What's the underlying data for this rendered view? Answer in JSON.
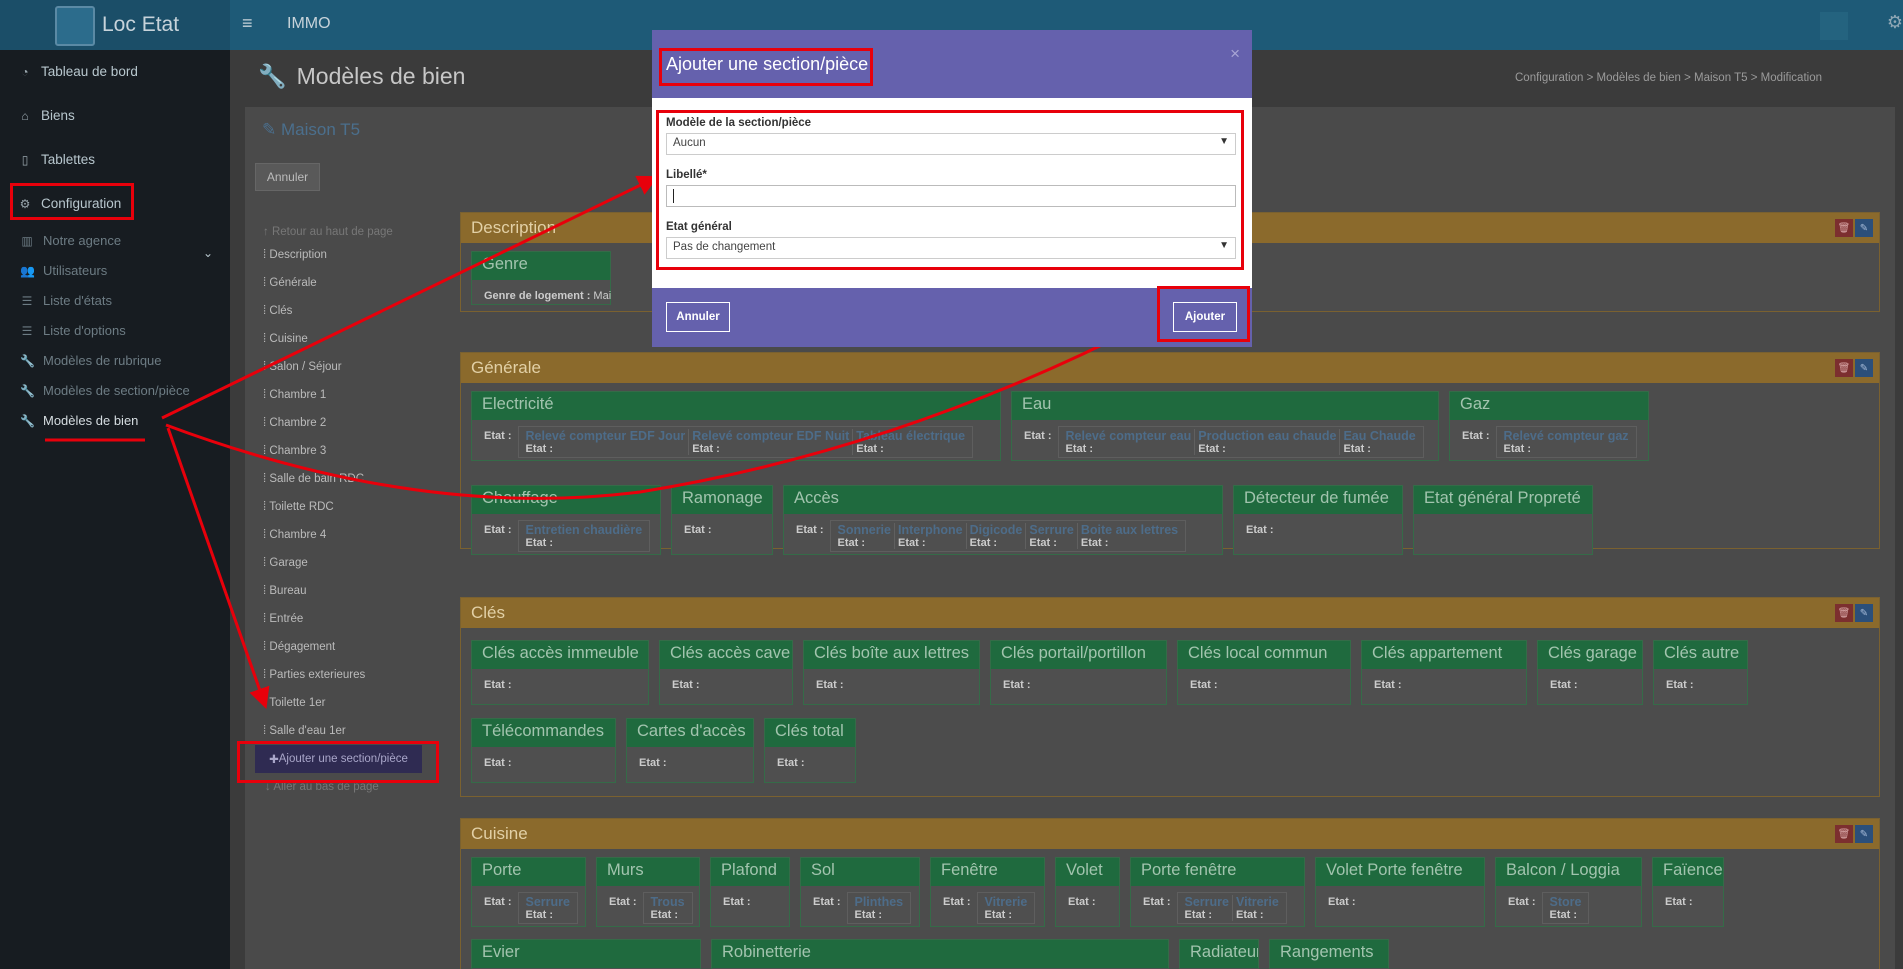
{
  "app": {
    "brand": "Loc Etat",
    "title": "IMMO"
  },
  "sidebar": {
    "items": [
      {
        "label": "Tableau de bord"
      },
      {
        "label": "Biens"
      },
      {
        "label": "Tablettes"
      },
      {
        "label": "Configuration"
      }
    ],
    "sub_items": [
      {
        "label": "Notre agence"
      },
      {
        "label": "Utilisateurs"
      },
      {
        "label": "Liste d'états"
      },
      {
        "label": "Liste d'options"
      },
      {
        "label": "Modèles de rubrique"
      },
      {
        "label": "Modèles de section/pièce"
      },
      {
        "label": "Modèles de bien"
      }
    ]
  },
  "page": {
    "title": "Modèles de bien",
    "breadcrumb": [
      "Configuration",
      "Modèles de bien",
      "Maison T5",
      "Modification"
    ],
    "box_title": "Maison T5",
    "cancel_label": "Annuler"
  },
  "toc": {
    "top": "Retour au haut de page",
    "items": [
      "Description",
      "Générale",
      "Clés",
      "Cuisine",
      "Salon / Séjour",
      "Chambre 1",
      "Chambre 2",
      "Chambre 3",
      "Salle de bain RDC",
      "Toilette RDC",
      "Chambre 4",
      "Garage",
      "Bureau",
      "Entrée",
      "Dégagement",
      "Parties exterieures",
      "Toilette 1er",
      "Salle d'eau 1er"
    ],
    "add_button": "Ajouter une section/pièce",
    "bottom": "Aller au bas de page"
  },
  "sections": {
    "description": {
      "title": "Description",
      "genre": "Genre",
      "genre_label": "Genre de logement :",
      "genre_value": "Mai"
    },
    "generale": {
      "title": "Générale",
      "electricite": "Electricité",
      "eau": "Eau",
      "gaz": "Gaz",
      "chauffage": "Chauffage",
      "ramonage": "Ramonage",
      "acces": "Accès",
      "detecteur": "Détecteur de fumée",
      "proprete": "Etat général Propreté",
      "sub": {
        "edf_jour": "Relevé compteur EDF Jour",
        "edf_nuit": "Relevé compteur EDF Nuit",
        "tableau": "Tableau électrique",
        "compteur_eau": "Relevé compteur eau",
        "prod_eau": "Production eau chaude",
        "eau_chaude": "Eau Chaude",
        "compteur_gaz": "Relevé compteur gaz",
        "chaudiere": "Entretien chaudière",
        "sonnerie": "Sonnerie",
        "interphone": "Interphone",
        "digicode": "Digicode",
        "serrure": "Serrure",
        "boite": "Boite aux lettres"
      }
    },
    "cles": {
      "title": "Clés",
      "cards": [
        "Clés accès immeuble",
        "Clés accès cave",
        "Clés boîte aux lettres",
        "Clés portail/portillon",
        "Clés local commun",
        "Clés appartement",
        "Clés garage",
        "Clés autre",
        "Télécommandes",
        "Cartes d'accès",
        "Clés total"
      ]
    },
    "cuisine": {
      "title": "Cuisine",
      "cards": [
        "Porte",
        "Murs",
        "Plafond",
        "Sol",
        "Fenêtre",
        "Volet",
        "Porte fenêtre",
        "Volet Porte fenêtre",
        "Balcon / Loggia",
        "Faïence"
      ],
      "row2": [
        "Evier",
        "Robinetterie",
        "Radiateur",
        "Rangements"
      ],
      "sub": {
        "serrure": "Serrure",
        "trous": "Trous",
        "plinthes": "Plinthes",
        "vitrerie": "Vitrerie",
        "store": "Store"
      }
    },
    "etat_label": "Etat :"
  },
  "modal": {
    "title": "Ajouter une section/pièce",
    "close": "×",
    "model_label": "Modèle de la section/pièce",
    "model_value": "Aucun",
    "libelle_label": "Libellé*",
    "etat_label": "Etat général",
    "etat_value": "Pas de changement",
    "cancel": "Annuler",
    "submit": "Ajouter"
  },
  "colors": {
    "annotation_red": "#e8000b",
    "modal_purple": "#6561ad",
    "panel_orange": "#8b6a2c",
    "card_green": "#1f6a3e"
  }
}
